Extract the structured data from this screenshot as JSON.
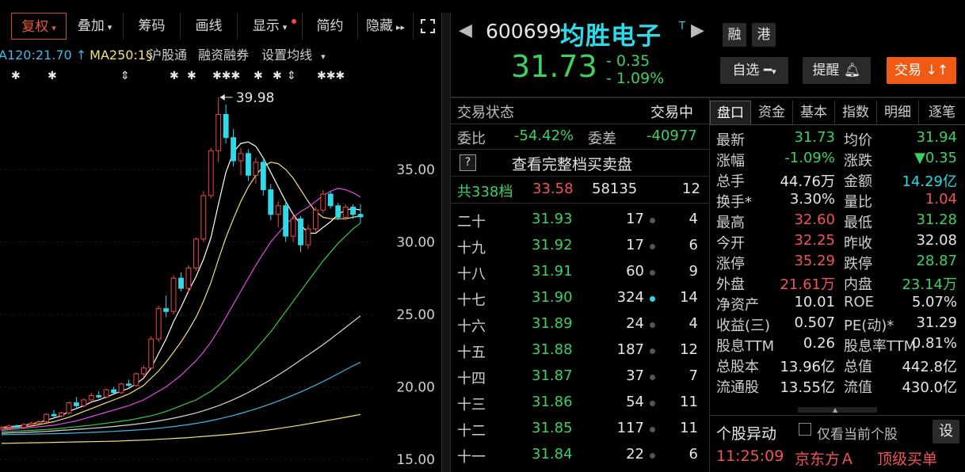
{
  "toolbar": {
    "items": [
      {
        "label": "复权",
        "caret": "▾"
      },
      {
        "label": "叠加",
        "caret": "▾"
      },
      {
        "label": "筹码"
      },
      {
        "label": "画线"
      },
      {
        "label": "显示",
        "caret": "▾"
      },
      {
        "label": "简约"
      },
      {
        "label": "隐藏",
        "caret": "▸▸"
      }
    ],
    "expand_icon": "expand-icon"
  },
  "ma_row": {
    "ma120": "A120:21.70 ↑",
    "ma250": "MA250:1§",
    "hgt": "沪股通",
    "rzrq": "融资融券",
    "settings": "设置均线",
    "settings_caret": "▾",
    "colors": {
      "ma120": "#3fb7e8",
      "ma250": "#f3e27a",
      "links": "#cfcfcf"
    }
  },
  "chart_data": {
    "type": "candlestick",
    "y_ticks": [
      "35.00",
      "30.00",
      "25.00",
      "20.00",
      "15.00"
    ],
    "ylim": [
      15,
      40
    ],
    "high_label": "39.98",
    "candles": [
      [
        17.1,
        17.3,
        17.0,
        17.2
      ],
      [
        17.2,
        17.4,
        17.1,
        17.3
      ],
      [
        17.3,
        17.4,
        17.2,
        17.2
      ],
      [
        17.2,
        17.5,
        17.1,
        17.4
      ],
      [
        17.4,
        17.6,
        17.3,
        17.5
      ],
      [
        17.5,
        17.7,
        17.4,
        17.6
      ],
      [
        17.6,
        18.2,
        17.5,
        18.1
      ],
      [
        18.1,
        18.4,
        17.9,
        18.0
      ],
      [
        18.0,
        18.3,
        17.9,
        18.2
      ],
      [
        18.2,
        19.0,
        18.1,
        18.9
      ],
      [
        18.9,
        19.3,
        18.5,
        18.7
      ],
      [
        18.7,
        19.2,
        18.6,
        19.1
      ],
      [
        19.1,
        19.6,
        19.0,
        19.4
      ],
      [
        19.4,
        19.7,
        19.2,
        19.3
      ],
      [
        19.3,
        19.9,
        19.2,
        19.8
      ],
      [
        19.8,
        20.0,
        19.5,
        19.6
      ],
      [
        19.6,
        20.3,
        19.5,
        20.2
      ],
      [
        20.2,
        20.5,
        20.0,
        20.1
      ],
      [
        20.1,
        21.0,
        20.0,
        20.9
      ],
      [
        20.9,
        21.5,
        20.7,
        21.3
      ],
      [
        21.3,
        23.5,
        21.2,
        23.3
      ],
      [
        23.3,
        25.6,
        23.1,
        25.4
      ],
      [
        25.4,
        26.3,
        24.8,
        25.2
      ],
      [
        25.2,
        27.7,
        25.0,
        27.5
      ],
      [
        27.5,
        27.9,
        26.6,
        26.8
      ],
      [
        26.8,
        28.4,
        26.5,
        28.2
      ],
      [
        28.2,
        30.3,
        28.0,
        30.2
      ],
      [
        30.2,
        33.5,
        30.0,
        33.2
      ],
      [
        33.2,
        36.5,
        33.0,
        36.3
      ],
      [
        36.3,
        39.98,
        35.5,
        38.8
      ],
      [
        38.8,
        39.5,
        36.8,
        37.2
      ],
      [
        37.2,
        37.8,
        35.2,
        35.6
      ],
      [
        35.6,
        36.5,
        34.6,
        36.1
      ],
      [
        36.1,
        36.4,
        34.2,
        34.6
      ],
      [
        34.6,
        35.8,
        34.0,
        35.5
      ],
      [
        35.5,
        35.8,
        33.2,
        33.6
      ],
      [
        33.6,
        34.0,
        31.5,
        31.9
      ],
      [
        31.9,
        32.8,
        31.0,
        32.5
      ],
      [
        32.5,
        32.9,
        30.0,
        30.4
      ],
      [
        30.4,
        31.9,
        30.0,
        31.6
      ],
      [
        31.6,
        31.8,
        29.3,
        29.8
      ],
      [
        29.8,
        31.2,
        29.5,
        30.9
      ],
      [
        30.9,
        32.4,
        30.7,
        32.2
      ],
      [
        32.2,
        33.6,
        32.0,
        33.3
      ],
      [
        33.3,
        33.5,
        32.3,
        32.5
      ],
      [
        32.5,
        32.7,
        31.5,
        31.7
      ],
      [
        31.7,
        32.6,
        31.5,
        32.4
      ],
      [
        32.4,
        32.6,
        31.6,
        31.9
      ],
      [
        31.9,
        32.6,
        31.3,
        31.73
      ]
    ],
    "ma_lines": [
      {
        "name": "MA5",
        "color": "#ffffff",
        "values": [
          17.2,
          17.25,
          17.3,
          17.35,
          17.45,
          17.55,
          17.7,
          17.85,
          18.0,
          18.3,
          18.5,
          18.7,
          18.95,
          19.1,
          19.3,
          19.5,
          19.7,
          19.9,
          20.2,
          20.6,
          21.3,
          22.3,
          23.3,
          24.5,
          25.5,
          26.6,
          27.6,
          28.8,
          30.3,
          32.6,
          34.8,
          36.2,
          36.8,
          36.9,
          36.6,
          35.8,
          34.8,
          33.8,
          32.8,
          31.9,
          31.2,
          30.6,
          30.6,
          31.0,
          31.4,
          31.9,
          32.2,
          32.3,
          32.2
        ]
      },
      {
        "name": "MA10",
        "color": "#f3e27a",
        "values": [
          17.1,
          17.15,
          17.2,
          17.25,
          17.3,
          17.4,
          17.5,
          17.6,
          17.75,
          17.9,
          18.1,
          18.3,
          18.5,
          18.7,
          18.9,
          19.1,
          19.3,
          19.5,
          19.8,
          20.1,
          20.6,
          21.1,
          21.7,
          22.4,
          23.1,
          23.9,
          24.8,
          25.9,
          27.2,
          28.8,
          30.3,
          31.6,
          32.8,
          33.8,
          34.6,
          35.2,
          35.5,
          35.4,
          35.0,
          34.4,
          33.6,
          32.8,
          32.1,
          31.7,
          31.6,
          31.6,
          31.6,
          31.7,
          31.8
        ]
      },
      {
        "name": "MA20",
        "color": "#e04ce0",
        "values": [
          17.0,
          17.05,
          17.1,
          17.15,
          17.2,
          17.25,
          17.3,
          17.35,
          17.45,
          17.55,
          17.65,
          17.8,
          17.95,
          18.1,
          18.25,
          18.4,
          18.55,
          18.7,
          18.9,
          19.1,
          19.4,
          19.7,
          20.0,
          20.4,
          20.8,
          21.3,
          21.8,
          22.4,
          23.1,
          23.9,
          24.8,
          25.7,
          26.6,
          27.5,
          28.4,
          29.2,
          30.0,
          30.6,
          31.2,
          31.7,
          32.1,
          32.4,
          32.8,
          33.2,
          33.5,
          33.7,
          33.6,
          33.4,
          33.1
        ]
      },
      {
        "name": "MA60",
        "color": "#39c93f",
        "values": [
          16.9,
          16.92,
          16.95,
          16.98,
          17.0,
          17.03,
          17.06,
          17.1,
          17.14,
          17.2,
          17.25,
          17.3,
          17.36,
          17.42,
          17.5,
          17.56,
          17.63,
          17.7,
          17.8,
          17.9,
          18.0,
          18.15,
          18.3,
          18.5,
          18.7,
          18.9,
          19.1,
          19.4,
          19.7,
          20.1,
          20.5,
          21.0,
          21.5,
          22.0,
          22.6,
          23.2,
          23.8,
          24.5,
          25.2,
          25.9,
          26.6,
          27.3,
          28.0,
          28.7,
          29.3,
          29.9,
          30.4,
          30.9,
          31.3
        ]
      },
      {
        "name": "MA90",
        "color": "#d8d8d8",
        "values": [
          16.8,
          16.82,
          16.84,
          16.86,
          16.88,
          16.9,
          16.93,
          16.96,
          17.0,
          17.03,
          17.07,
          17.1,
          17.14,
          17.18,
          17.22,
          17.27,
          17.32,
          17.37,
          17.43,
          17.5,
          17.57,
          17.65,
          17.74,
          17.84,
          17.95,
          18.07,
          18.2,
          18.35,
          18.52,
          18.7,
          18.9,
          19.12,
          19.36,
          19.62,
          19.9,
          20.2,
          20.5,
          20.82,
          21.15,
          21.5,
          21.85,
          22.2,
          22.56,
          22.92,
          23.3,
          23.7,
          24.1,
          24.5,
          24.9
        ]
      },
      {
        "name": "MA120",
        "color": "#3fb7e8",
        "values": [
          16.7,
          16.71,
          16.72,
          16.73,
          16.74,
          16.75,
          16.76,
          16.77,
          16.78,
          16.8,
          16.82,
          16.84,
          16.86,
          16.88,
          16.9,
          16.93,
          16.96,
          16.99,
          17.02,
          17.06,
          17.1,
          17.15,
          17.2,
          17.26,
          17.33,
          17.4,
          17.48,
          17.57,
          17.67,
          17.78,
          17.9,
          18.03,
          18.17,
          18.32,
          18.48,
          18.65,
          18.83,
          19.02,
          19.22,
          19.43,
          19.65,
          19.88,
          20.12,
          20.37,
          20.63,
          20.9,
          21.18,
          21.45,
          21.7
        ]
      },
      {
        "name": "MA250",
        "color": "#f3e27a",
        "values": [
          16.1,
          16.11,
          16.12,
          16.13,
          16.14,
          16.15,
          16.16,
          16.17,
          16.18,
          16.19,
          16.2,
          16.21,
          16.22,
          16.23,
          16.24,
          16.25,
          16.27,
          16.29,
          16.31,
          16.33,
          16.35,
          16.38,
          16.41,
          16.44,
          16.47,
          16.5,
          16.54,
          16.58,
          16.62,
          16.66,
          16.7,
          16.75,
          16.8,
          16.86,
          16.92,
          16.98,
          17.05,
          17.12,
          17.2,
          17.28,
          17.36,
          17.45,
          17.54,
          17.63,
          17.72,
          17.81,
          17.9,
          18.0,
          18.1
        ]
      }
    ]
  },
  "quote": {
    "code": "600699",
    "name": "均胜电子",
    "name_tag": "T",
    "price": "31.73",
    "change": "- 0.35",
    "change_pct": "- 1.09%",
    "tags": [
      "融",
      "港"
    ],
    "watchlist": "自选",
    "alert": "提醒",
    "trade": "交易",
    "trade_icon": "↓↑"
  },
  "orderbook": {
    "status_label": "交易状态",
    "status_value": "交易中",
    "wb_label": "委比",
    "wb_value": "-54.42%",
    "wc_label": "委差",
    "wc_value": "-40977",
    "help_icon": "?",
    "full_book": "查看完整档买卖盘",
    "summary": {
      "label": "共338档",
      "price": "33.58",
      "volume": "58135",
      "count": "12"
    },
    "rows": [
      {
        "label": "二十",
        "price": "31.93",
        "vol": "17",
        "count": "4"
      },
      {
        "label": "十九",
        "price": "31.92",
        "vol": "17",
        "count": "6"
      },
      {
        "label": "十八",
        "price": "31.91",
        "vol": "60",
        "count": "9"
      },
      {
        "label": "十七",
        "price": "31.90",
        "vol": "324",
        "count": "14"
      },
      {
        "label": "十六",
        "price": "31.89",
        "vol": "24",
        "count": "4"
      },
      {
        "label": "十五",
        "price": "31.88",
        "vol": "187",
        "count": "12"
      },
      {
        "label": "十四",
        "price": "31.87",
        "vol": "37",
        "count": "7"
      },
      {
        "label": "十三",
        "price": "31.86",
        "vol": "54",
        "count": "11"
      },
      {
        "label": "十二",
        "price": "31.85",
        "vol": "117",
        "count": "11"
      },
      {
        "label": "十一",
        "price": "31.84",
        "vol": "22",
        "count": "6"
      }
    ]
  },
  "tabs": [
    "盘口",
    "资金",
    "基本",
    "指数",
    "明细",
    "逐笔"
  ],
  "stats": [
    [
      {
        "label": "最新",
        "value": "31.73",
        "c": "green"
      },
      {
        "label": "均价",
        "value": "31.94",
        "c": "green"
      }
    ],
    [
      {
        "label": "涨幅",
        "value": "-1.09%",
        "c": "green"
      },
      {
        "label": "涨跌",
        "value": "▼0.35",
        "c": "green"
      }
    ],
    [
      {
        "label": "总手",
        "value": "44.76万",
        "c": "white"
      },
      {
        "label": "金额",
        "value": "14.29亿",
        "c": "cyan"
      }
    ],
    [
      {
        "label": "换手*",
        "value": "3.30%",
        "c": "white"
      },
      {
        "label": "量比",
        "value": "1.04",
        "c": "red"
      }
    ],
    [
      {
        "label": "最高",
        "value": "32.60",
        "c": "red"
      },
      {
        "label": "最低",
        "value": "31.28",
        "c": "green"
      }
    ],
    [
      {
        "label": "今开",
        "value": "32.25",
        "c": "red"
      },
      {
        "label": "昨收",
        "value": "32.08",
        "c": "white"
      }
    ],
    [
      {
        "label": "涨停",
        "value": "35.29",
        "c": "red"
      },
      {
        "label": "跌停",
        "value": "28.87",
        "c": "green"
      }
    ],
    [
      {
        "label": "外盘",
        "value": "21.61万",
        "c": "red"
      },
      {
        "label": "内盘",
        "value": "23.14万",
        "c": "green"
      }
    ],
    [
      {
        "label": "净资产",
        "value": "10.01",
        "c": "white"
      },
      {
        "label": "ROE",
        "value": "5.07%",
        "c": "white"
      }
    ],
    [
      {
        "label": "收益(三)",
        "value": "0.507",
        "c": "white"
      },
      {
        "label": "PE(动)*",
        "value": "31.29",
        "c": "white"
      }
    ],
    [
      {
        "label": "股息TTM",
        "value": "0.26",
        "c": "white"
      },
      {
        "label": "股息率TTM",
        "value": "0.81%",
        "c": "white"
      }
    ],
    [
      {
        "label": "总股本",
        "value": "13.96亿",
        "c": "white"
      },
      {
        "label": "总值",
        "value": "442.8亿",
        "c": "white"
      }
    ],
    [
      {
        "label": "流通股",
        "value": "13.55亿",
        "c": "white"
      },
      {
        "label": "流值",
        "value": "430.0亿",
        "c": "white"
      }
    ]
  ],
  "movers": {
    "title": "个股异动",
    "only_current": "仅看当前个股",
    "settings": "设",
    "item": {
      "time": "11:25:09",
      "stock": "京东方Ａ",
      "event": "顶级买单"
    }
  }
}
